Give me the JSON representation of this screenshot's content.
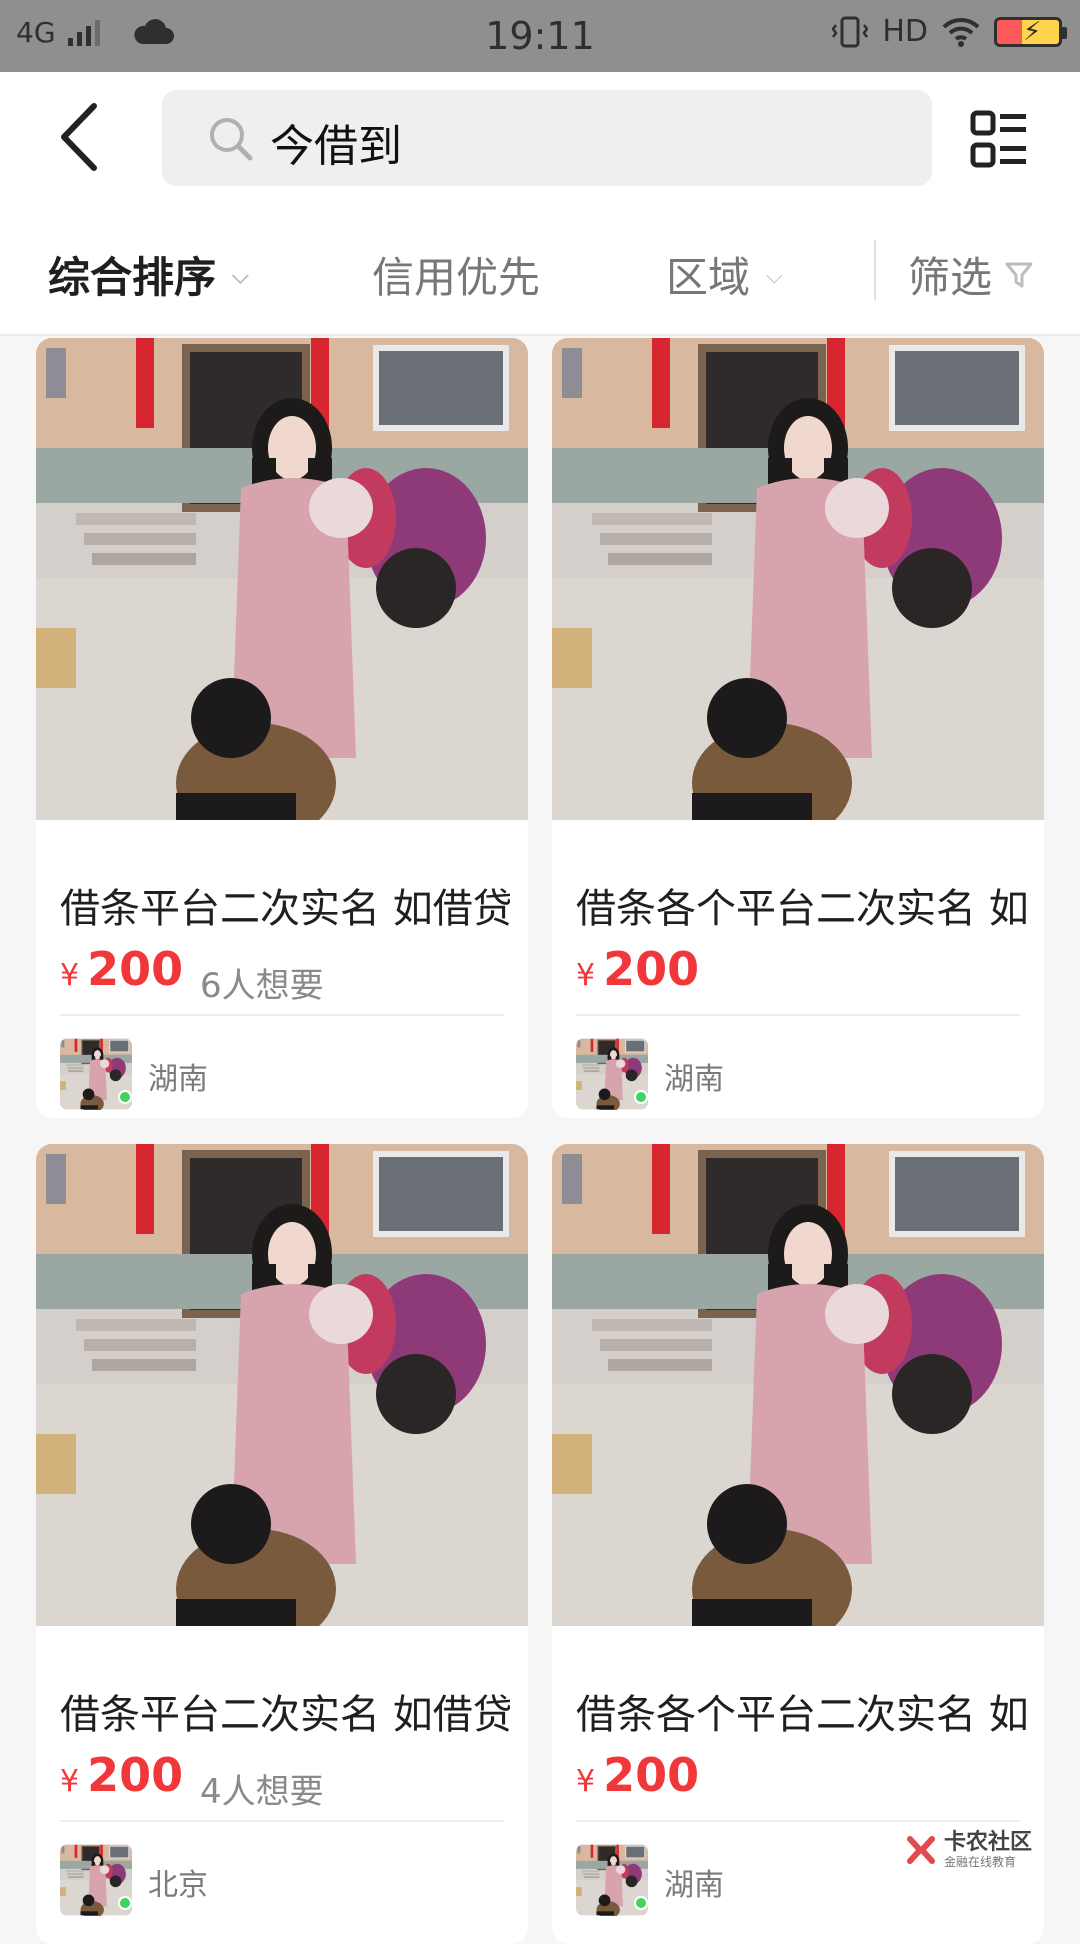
{
  "status_bar": {
    "network": "4G",
    "time": "19:11",
    "hd": "HD"
  },
  "header": {
    "search_value": "今借到"
  },
  "filters": [
    {
      "label": "综合排序",
      "active": true
    },
    {
      "label": "信用优先",
      "active": false
    },
    {
      "label": "区域",
      "active": false
    },
    {
      "label": "筛选",
      "active": false
    }
  ],
  "listings": [
    {
      "title": "借条平台二次实名 如借贷",
      "currency": "¥",
      "price": "200",
      "want": "6人想要",
      "location": "湖南"
    },
    {
      "title": "借条各个平台二次实名 如",
      "currency": "¥",
      "price": "200",
      "want": "",
      "location": "湖南"
    },
    {
      "title": "借条平台二次实名 如借贷",
      "currency": "¥",
      "price": "200",
      "want": "4人想要",
      "location": "北京"
    },
    {
      "title": "借条各个平台二次实名 如",
      "currency": "¥",
      "price": "200",
      "want": "",
      "location": "湖南"
    }
  ],
  "watermark": {
    "name": "卡农社区",
    "tagline": "金融在线教育"
  },
  "colors": {
    "price": "#f0383a",
    "online": "#41d35f"
  }
}
